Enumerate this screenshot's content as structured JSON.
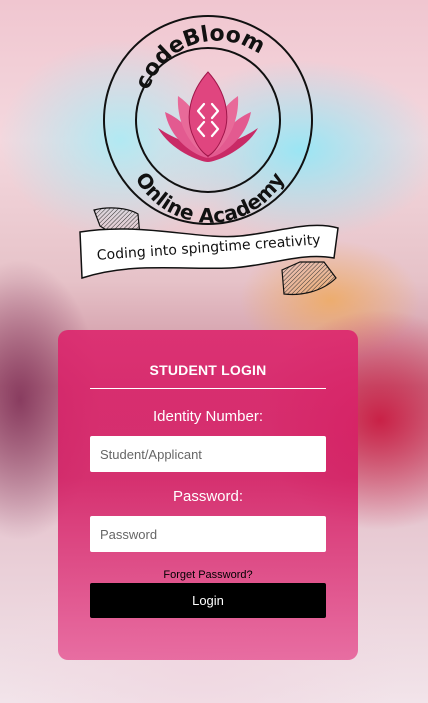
{
  "brand": {
    "name": "codeBloom",
    "subtitle": "Online Academy",
    "tagline": "Coding into spingtime creativity"
  },
  "login": {
    "title": "STUDENT LOGIN",
    "identity_label": "Identity Number:",
    "identity_placeholder": "Student/Applicant",
    "password_label": "Password:",
    "password_placeholder": "Password",
    "forgot_label": "Forget Password?",
    "login_button": "Login"
  },
  "colors": {
    "card": "#d81e64",
    "lotus": "#e0457f",
    "button": "#000000"
  }
}
